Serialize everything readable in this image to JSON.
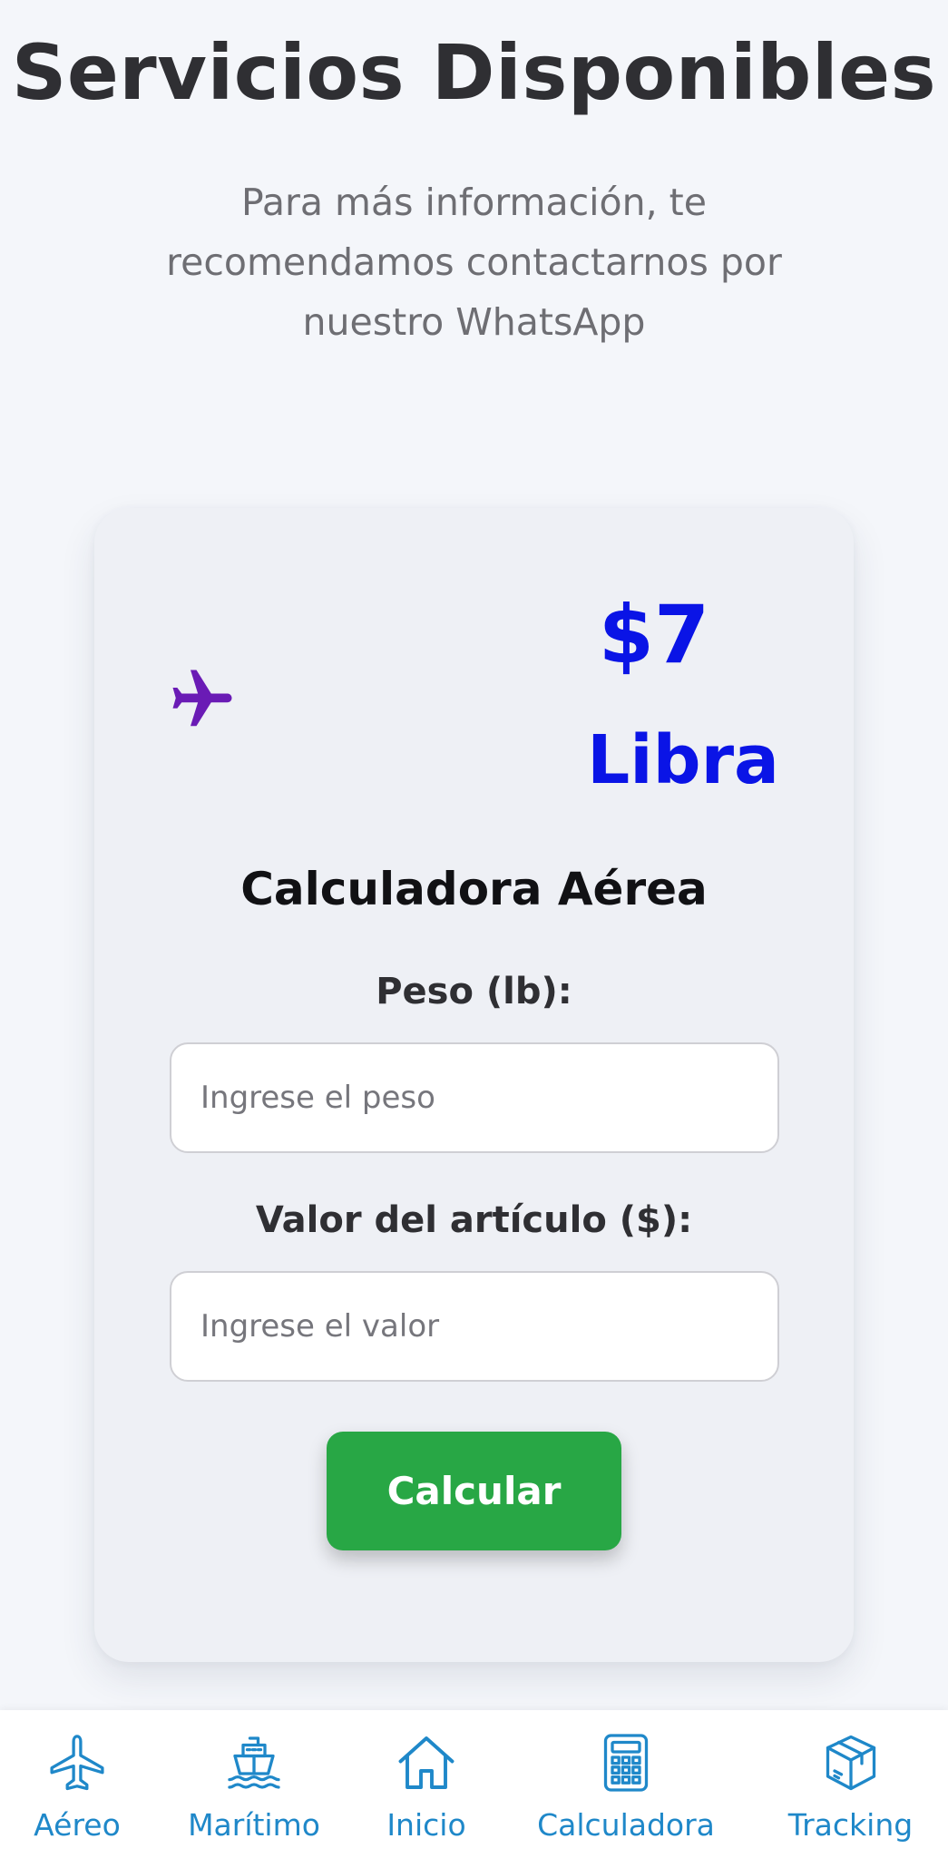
{
  "header": {
    "title": "Servicios Disponibles",
    "subtitle": "Para más información, te recomendamos contactarnos por nuestro WhatsApp"
  },
  "card": {
    "service_icon": "airplane-icon",
    "price": "$7",
    "unit": "Libra",
    "calculator_title": "Calculadora Aérea",
    "weight_label": "Peso (lb):",
    "weight_placeholder": "Ingrese el peso",
    "value_label": "Valor del artículo ($):",
    "value_placeholder": "Ingrese el valor",
    "calculate_label": "Calcular"
  },
  "bottom_nav": {
    "items": [
      {
        "label": "Aéreo",
        "icon": "airplane-icon"
      },
      {
        "label": "Marítimo",
        "icon": "ship-icon"
      },
      {
        "label": "Inicio",
        "icon": "home-icon"
      },
      {
        "label": "Calculadora",
        "icon": "calculator-icon"
      },
      {
        "label": "Tracking",
        "icon": "package-icon"
      }
    ]
  },
  "colors": {
    "background": "#f4f6fa",
    "card": "#eef0f5",
    "price": "#0a14e6",
    "service_icon": "#6a1bb5",
    "button": "#28a745",
    "nav": "#1f88c9"
  }
}
